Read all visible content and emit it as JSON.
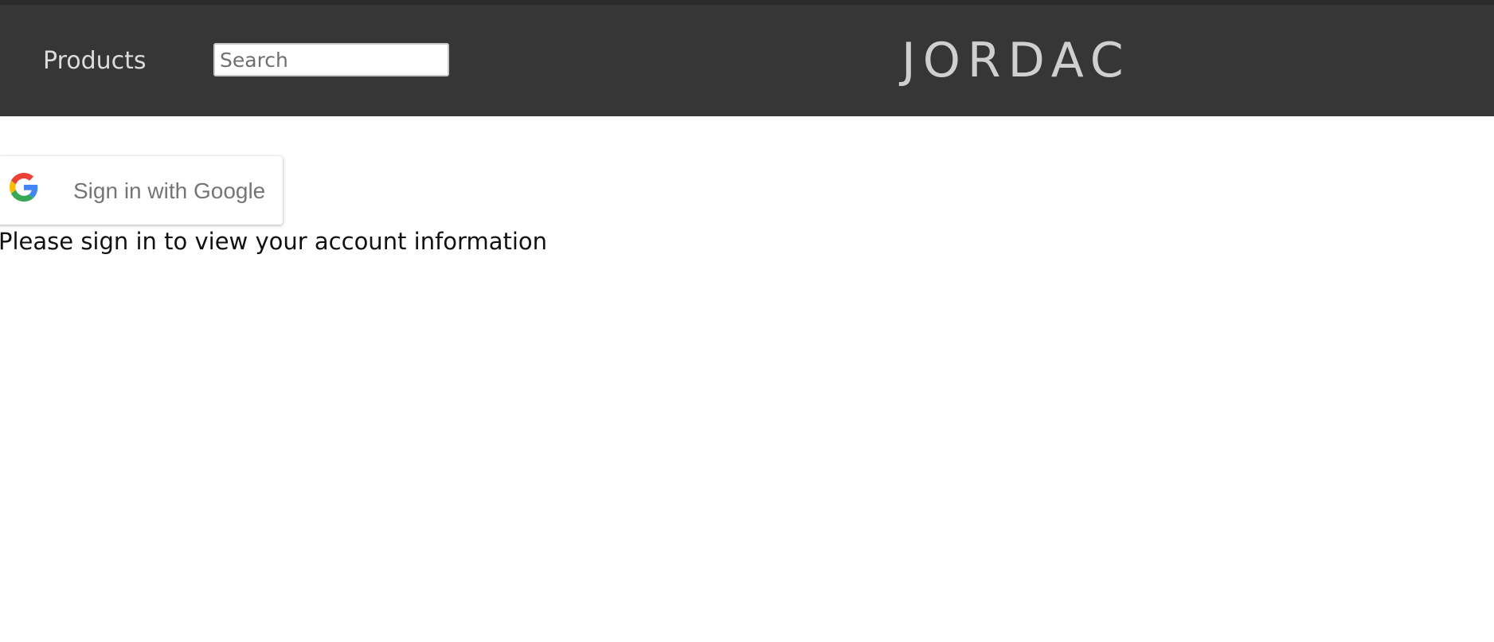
{
  "header": {
    "nav": {
      "products_label": "Products"
    },
    "search": {
      "placeholder": "Search",
      "value": ""
    },
    "logo_text": "JORDAC"
  },
  "auth": {
    "google_button_label": "Sign in with Google",
    "google_icon": "google-g-icon",
    "message": "Please sign in to view your account information"
  },
  "colors": {
    "header_bg": "#363636",
    "page_bg": "#ffffff",
    "logo": "#cfcfcf",
    "google_blue": "#4285F4",
    "google_red": "#EA4335",
    "google_yellow": "#FBBC05",
    "google_green": "#34A853"
  }
}
